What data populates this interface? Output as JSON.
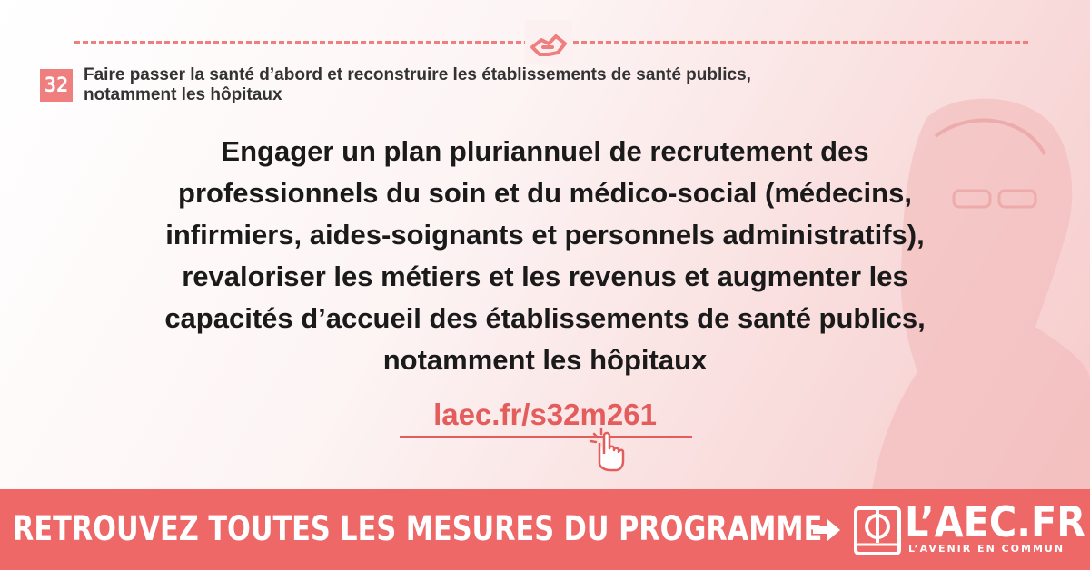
{
  "badge": {
    "number": "32"
  },
  "subtitle": {
    "line1": "Faire passer la santé d’abord et reconstruire les établissements de santé publics,",
    "line2": "notamment les hôpitaux"
  },
  "main": {
    "lines": [
      "Engager un plan pluriannuel de recrutement des",
      "professionnels du soin et du médico-social (médecins,",
      "infirmiers, aides-soignants et personnels administratifs),",
      "revaloriser les métiers et les revenus et augmenter les",
      "capacités d’accueil des établissements de santé publics,",
      "notamment les hôpitaux"
    ]
  },
  "link": {
    "text": "laec.fr/s32m261"
  },
  "footer": {
    "cta": "RETROUVEZ TOUTES LES MESURES DU PROGRAMME",
    "logo": "L’AEC.FR",
    "tagline": "L’AVENIR EN COMMUN"
  },
  "icons": {
    "handshake": "handshake-icon",
    "click": "pointer-click-icon",
    "arrow": "arrow-right-icon",
    "logo": "phi-book-logo-icon"
  },
  "colors": {
    "accent": "#ef6868",
    "badge": "#ef7f7f",
    "link": "#e35d5d",
    "text": "#1a1a1a"
  }
}
